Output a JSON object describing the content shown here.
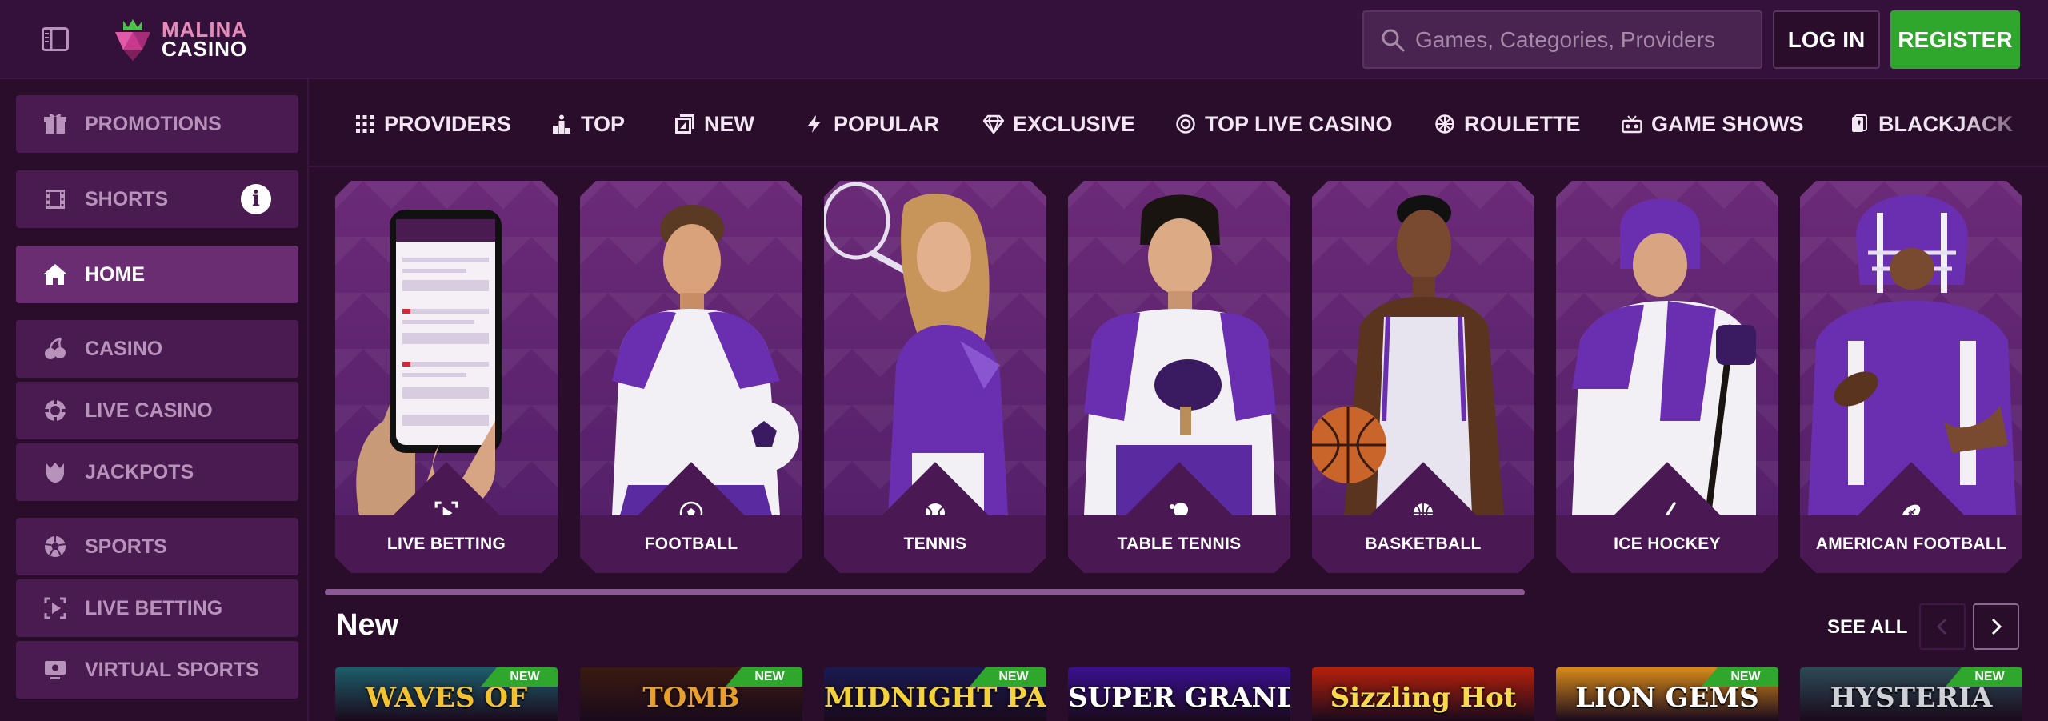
{
  "header": {
    "logo": {
      "line1": "MALINA",
      "line2": "CASINO"
    },
    "search": {
      "placeholder": "Games, Categories, Providers"
    },
    "login_label": "LOG IN",
    "register_label": "REGISTER"
  },
  "sidebar": {
    "items": [
      {
        "label": "PROMOTIONS",
        "icon": "gift-icon"
      },
      {
        "label": "SHORTS",
        "icon": "film-icon",
        "info": "i"
      },
      {
        "label": "HOME",
        "icon": "home-icon",
        "active": true
      },
      {
        "label": "CASINO",
        "icon": "cherries-icon"
      },
      {
        "label": "LIVE CASINO",
        "icon": "chip-icon"
      },
      {
        "label": "JACKPOTS",
        "icon": "trophy-icon"
      },
      {
        "label": "SPORTS",
        "icon": "soccer-ball-icon"
      },
      {
        "label": "LIVE BETTING",
        "icon": "live-play-icon"
      },
      {
        "label": "VIRTUAL SPORTS",
        "icon": "monitor-icon"
      }
    ]
  },
  "categories": [
    {
      "label": "PROVIDERS",
      "icon": "grid-icon"
    },
    {
      "label": "TOP",
      "icon": "podium-icon"
    },
    {
      "label": "NEW",
      "icon": "new-icon"
    },
    {
      "label": "POPULAR",
      "icon": "bolt-icon"
    },
    {
      "label": "EXCLUSIVE",
      "icon": "diamond-icon"
    },
    {
      "label": "TOP LIVE CASINO",
      "icon": "chip-icon"
    },
    {
      "label": "ROULETTE",
      "icon": "roulette-icon"
    },
    {
      "label": "GAME SHOWS",
      "icon": "gameshow-icon"
    },
    {
      "label": "BLACKJACK",
      "icon": "cards-icon"
    }
  ],
  "sports": [
    {
      "label": "LIVE BETTING",
      "icon": "live-play-icon"
    },
    {
      "label": "FOOTBALL",
      "icon": "soccer-ball-icon"
    },
    {
      "label": "TENNIS",
      "icon": "tennis-ball-icon"
    },
    {
      "label": "TABLE TENNIS",
      "icon": "ping-pong-icon"
    },
    {
      "label": "BASKETBALL",
      "icon": "basketball-icon"
    },
    {
      "label": "ICE HOCKEY",
      "icon": "hockey-stick-icon"
    },
    {
      "label": "AMERICAN FOOTBALL",
      "icon": "american-football-icon"
    }
  ],
  "new_section": {
    "title": "New",
    "see_all": "SEE ALL",
    "badge": "NEW",
    "games": [
      {
        "title": "WAVES OF",
        "color": "#f2c230",
        "bg": "#1d5d6b"
      },
      {
        "title": "TOMB",
        "color": "#e8a02a",
        "bg": "#3a1a10"
      },
      {
        "title": "MIDNIGHT PACK",
        "color": "#f4d23a",
        "bg": "#1a1a50"
      },
      {
        "title": "SUPER GRAND",
        "color": "#ffffff",
        "bg": "#3a1090"
      },
      {
        "title": "Sizzling Hot",
        "color": "#f7d94a",
        "bg": "#b5200a"
      },
      {
        "title": "LION GEMS",
        "color": "#ffffff",
        "bg": "#d68a1a"
      },
      {
        "title": "HYSTERIA",
        "color": "#d0d0d8",
        "bg": "#2d4a55"
      }
    ]
  },
  "colors": {
    "accent_green": "#2fa62c",
    "bg": "#2a0d2b",
    "card": "#4a1953"
  }
}
